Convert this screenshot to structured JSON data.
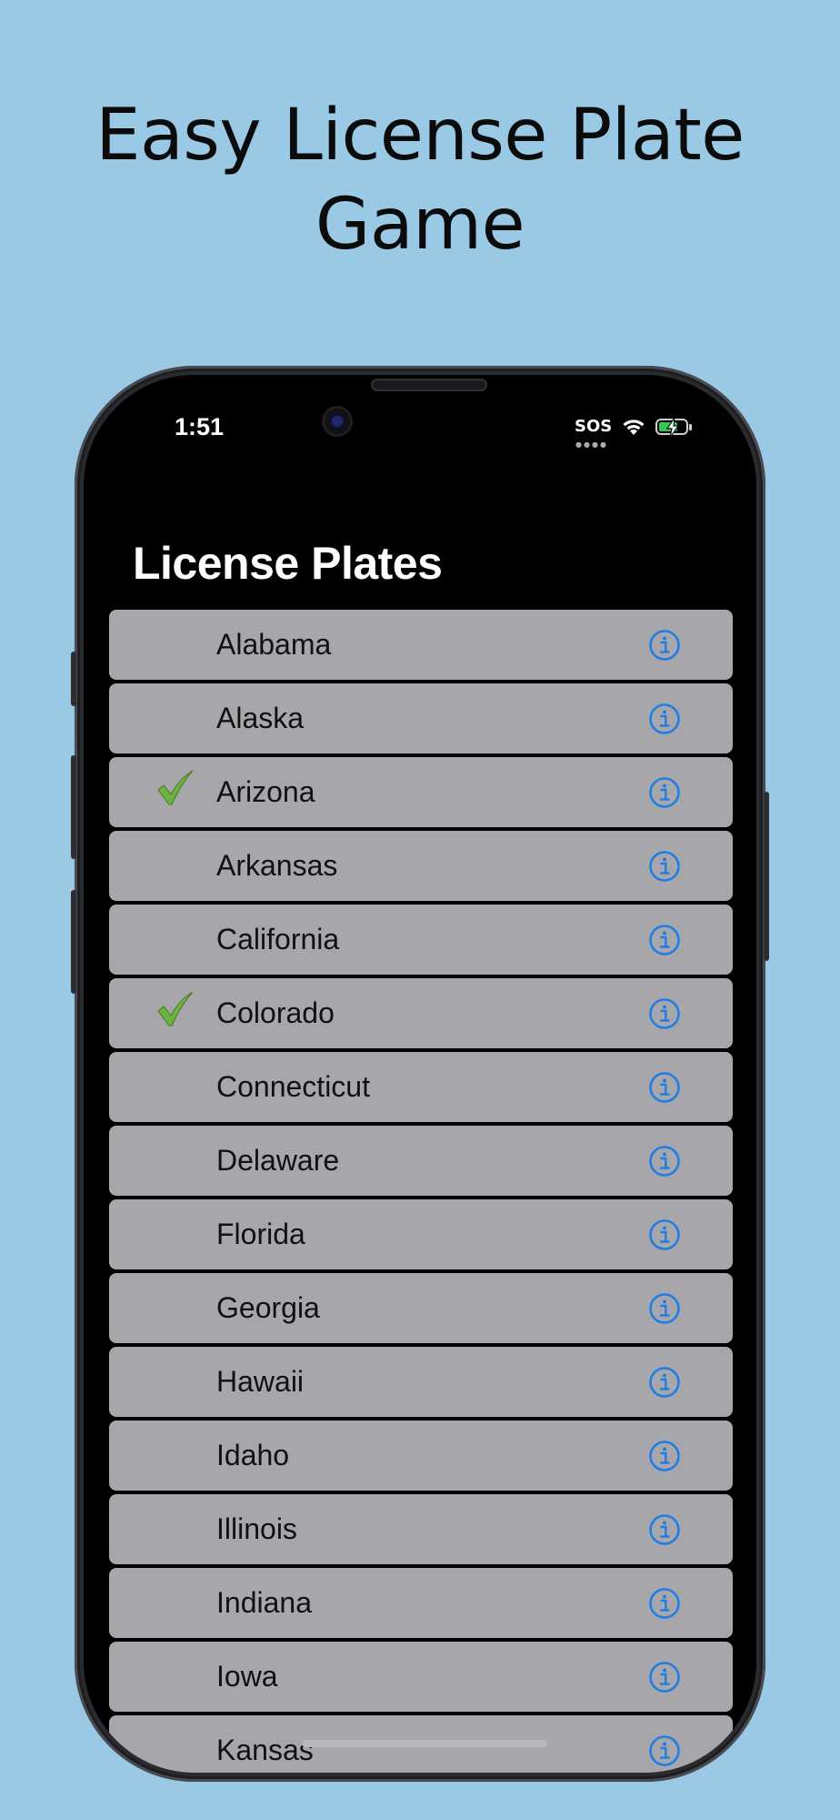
{
  "headline": {
    "line1": "Easy License Plate",
    "line2": "Game"
  },
  "status_bar": {
    "time": "1:51",
    "sos": "SOS"
  },
  "nav": {
    "title": "License Plates"
  },
  "colors": {
    "background": "#9ac9e6",
    "row_background": "#a7a7ab",
    "check_green": "#6db33f",
    "info_blue": "#1f7de6"
  },
  "states": [
    {
      "name": "Alabama",
      "checked": false
    },
    {
      "name": "Alaska",
      "checked": false
    },
    {
      "name": "Arizona",
      "checked": true
    },
    {
      "name": "Arkansas",
      "checked": false
    },
    {
      "name": "California",
      "checked": false
    },
    {
      "name": "Colorado",
      "checked": true
    },
    {
      "name": "Connecticut",
      "checked": false
    },
    {
      "name": "Delaware",
      "checked": false
    },
    {
      "name": "Florida",
      "checked": false
    },
    {
      "name": "Georgia",
      "checked": false
    },
    {
      "name": "Hawaii",
      "checked": false
    },
    {
      "name": "Idaho",
      "checked": false
    },
    {
      "name": "Illinois",
      "checked": false
    },
    {
      "name": "Indiana",
      "checked": false
    },
    {
      "name": "Iowa",
      "checked": false
    },
    {
      "name": "Kansas",
      "checked": false
    }
  ]
}
